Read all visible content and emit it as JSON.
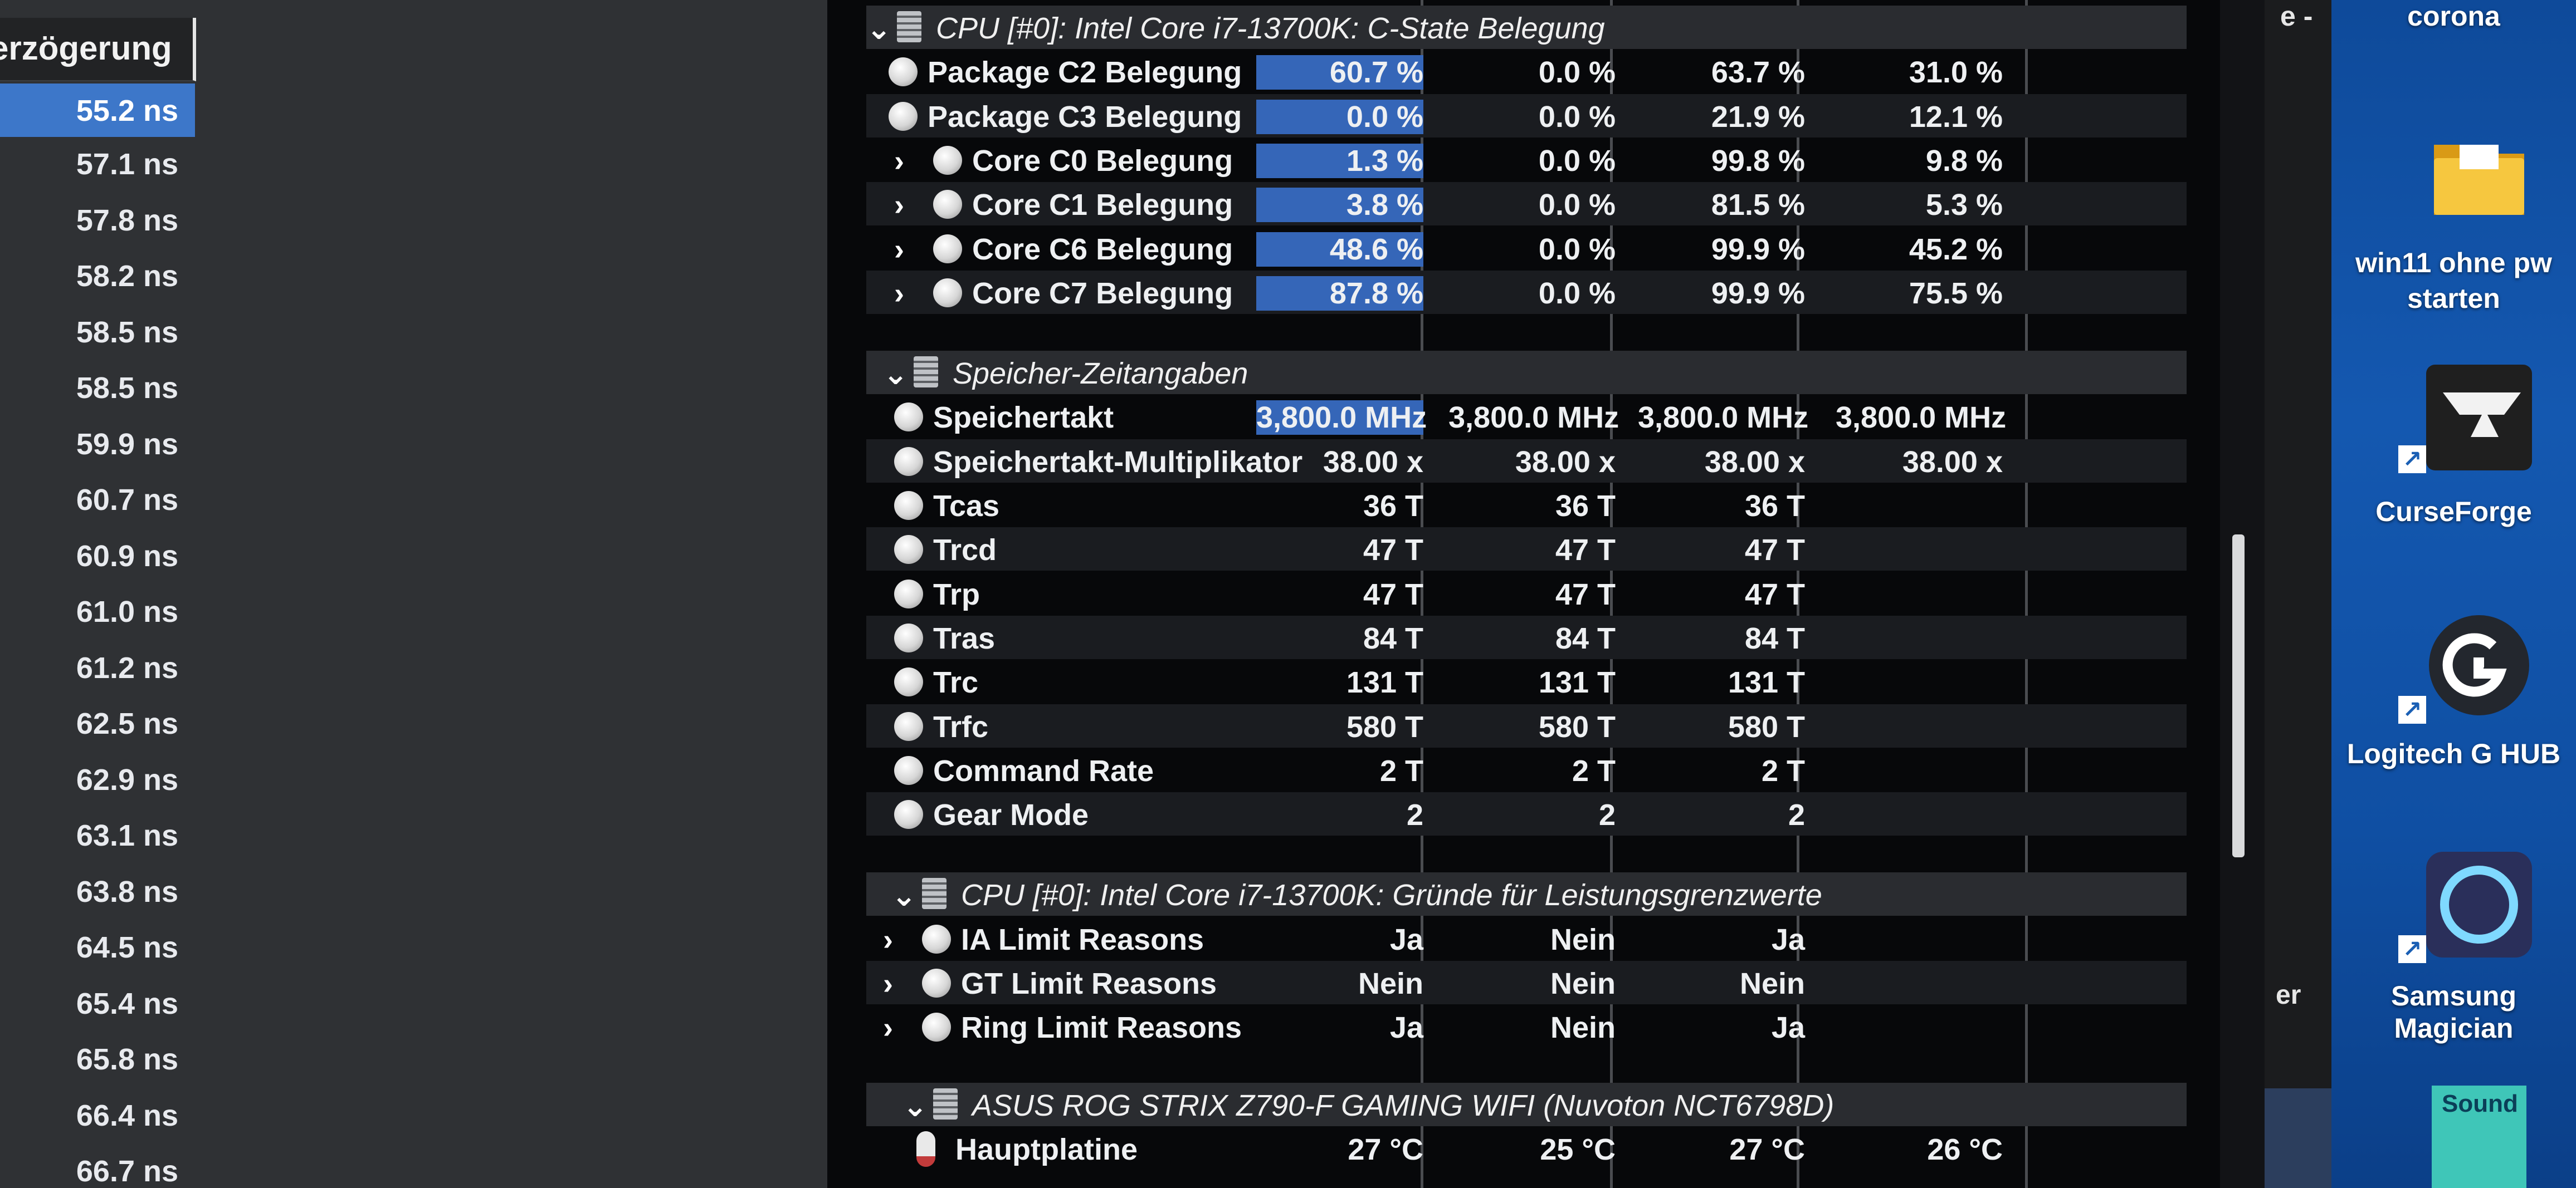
{
  "latency_pane": {
    "header": "erzögerung",
    "values": [
      "55.2 ns",
      "57.1 ns",
      "57.8 ns",
      "58.2 ns",
      "58.5 ns",
      "58.5 ns",
      "59.9 ns",
      "60.7 ns",
      "60.9 ns",
      "61.0 ns",
      "61.2 ns",
      "62.5 ns",
      "62.9 ns",
      "63.1 ns",
      "63.8 ns",
      "64.5 ns",
      "65.4 ns",
      "65.8 ns",
      "66.4 ns",
      "66.7 ns"
    ],
    "selected_index": 0
  },
  "sensors": {
    "cstate_group": {
      "title": "CPU [#0]: Intel Core i7-13700K: C-State Belegung",
      "rows": [
        {
          "label": "Package C2 Belegung",
          "values": [
            "60.7 %",
            "0.0 %",
            "63.7 %",
            "31.0 %"
          ],
          "expandable": false
        },
        {
          "label": "Package C3 Belegung",
          "values": [
            "0.0 %",
            "0.0 %",
            "21.9 %",
            "12.1 %"
          ],
          "expandable": false
        },
        {
          "label": "Core C0 Belegung",
          "values": [
            "1.3 %",
            "0.0 %",
            "99.8 %",
            "9.8 %"
          ],
          "expandable": true
        },
        {
          "label": "Core C1 Belegung",
          "values": [
            "3.8 %",
            "0.0 %",
            "81.5 %",
            "5.3 %"
          ],
          "expandable": true
        },
        {
          "label": "Core C6 Belegung",
          "values": [
            "48.6 %",
            "0.0 %",
            "99.9 %",
            "45.2 %"
          ],
          "expandable": true
        },
        {
          "label": "Core C7 Belegung",
          "values": [
            "87.8 %",
            "0.0 %",
            "99.9 %",
            "75.5 %"
          ],
          "expandable": true
        }
      ]
    },
    "memory_group": {
      "title": "Speicher-Zeitangaben",
      "rows": [
        {
          "label": "Speichertakt",
          "values": [
            "3,800.0 MHz",
            "3,800.0 MHz",
            "3,800.0 MHz",
            "3,800.0 MHz"
          ]
        },
        {
          "label": "Speichertakt-Multiplikator",
          "values": [
            "38.00 x",
            "38.00 x",
            "38.00 x",
            "38.00 x"
          ]
        },
        {
          "label": "Tcas",
          "values": [
            "36 T",
            "36 T",
            "36 T",
            ""
          ]
        },
        {
          "label": "Trcd",
          "values": [
            "47 T",
            "47 T",
            "47 T",
            ""
          ]
        },
        {
          "label": "Trp",
          "values": [
            "47 T",
            "47 T",
            "47 T",
            ""
          ]
        },
        {
          "label": "Tras",
          "values": [
            "84 T",
            "84 T",
            "84 T",
            ""
          ]
        },
        {
          "label": "Trc",
          "values": [
            "131 T",
            "131 T",
            "131 T",
            ""
          ]
        },
        {
          "label": "Trfc",
          "values": [
            "580 T",
            "580 T",
            "580 T",
            ""
          ]
        },
        {
          "label": "Command Rate",
          "values": [
            "2 T",
            "2 T",
            "2 T",
            ""
          ]
        },
        {
          "label": "Gear Mode",
          "values": [
            "2",
            "2",
            "2",
            ""
          ]
        }
      ]
    },
    "limits_group": {
      "title": "CPU [#0]: Intel Core i7-13700K: Gründe für Leistungsgrenzwerte",
      "rows": [
        {
          "label": "IA Limit Reasons",
          "values": [
            "Ja",
            "Nein",
            "Ja",
            ""
          ]
        },
        {
          "label": "GT Limit Reasons",
          "values": [
            "Nein",
            "Nein",
            "Nein",
            ""
          ]
        },
        {
          "label": "Ring Limit Reasons",
          "values": [
            "Ja",
            "Nein",
            "Ja",
            ""
          ]
        }
      ]
    },
    "board_group": {
      "title": "ASUS ROG STRIX Z790-F GAMING WIFI (Nuvoton NCT6798D)",
      "rows": [
        {
          "label": "Hauptplatine",
          "values": [
            "27 °C",
            "25 °C",
            "27 °C",
            "26 °C"
          ]
        }
      ]
    }
  },
  "right_strip": {
    "top_text": "e -",
    "mid_text": "er"
  },
  "desktop": {
    "icons": [
      {
        "label": "corona",
        "icon": "folder-icon"
      },
      {
        "label": "win11 ohne pw starten",
        "icon": "folder-icon"
      },
      {
        "label": "CurseForge",
        "icon": "anvil-icon"
      },
      {
        "label": "Logitech G HUB",
        "icon": "logitech-g-icon"
      },
      {
        "label": "Samsung Magician",
        "icon": "ring-icon"
      },
      {
        "label": "Sound",
        "icon": "sound-blaster-icon"
      }
    ]
  },
  "colors": {
    "highlight": "#3566b8",
    "selection": "#3d77c9",
    "desktop": "#1458b0"
  }
}
